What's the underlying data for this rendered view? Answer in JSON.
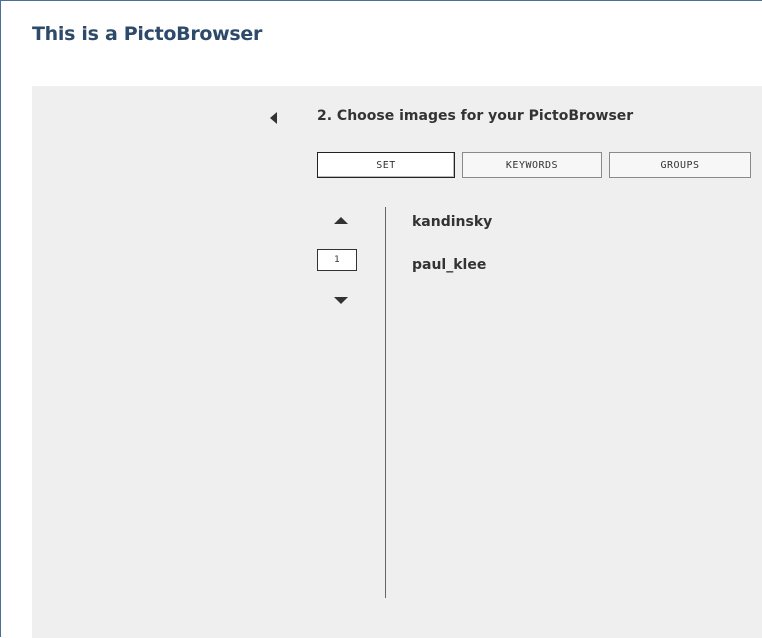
{
  "header": {
    "title": "This is a PictoBrowser"
  },
  "wizard": {
    "step_title": "2. Choose images for your PictoBrowser",
    "back_icon": "caret-left-icon",
    "tabs": [
      {
        "label": "SET",
        "active": true
      },
      {
        "label": "KEYWORDS",
        "active": false
      },
      {
        "label": "GROUPS",
        "active": false
      }
    ]
  },
  "pager": {
    "up_icon": "caret-up-icon",
    "down_icon": "caret-down-icon",
    "current_page": "1"
  },
  "sets": {
    "items": [
      {
        "label": "kandinsky"
      },
      {
        "label": "paul_klee"
      }
    ]
  },
  "colors": {
    "title": "#2e4a6b",
    "frame_border": "#4a6f9c",
    "panel_bg": "#efefef",
    "text": "#333333"
  }
}
